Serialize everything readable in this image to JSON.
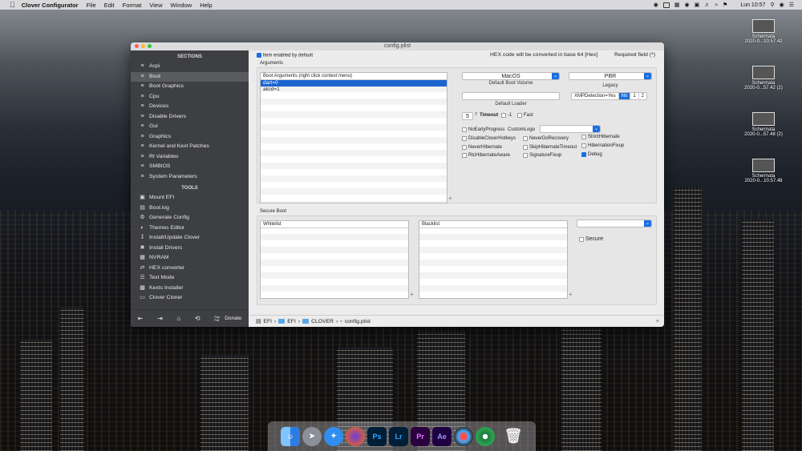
{
  "menubar": {
    "app": "Clover Configurator",
    "items": [
      "File",
      "Edit",
      "Format",
      "View",
      "Window",
      "Help"
    ],
    "clock": "Lun 10:57"
  },
  "desktop": [
    {
      "label": "Schermata",
      "sub": "2020-0...10.57.42"
    },
    {
      "label": "Schermata",
      "sub": "2020-0...57.42 (2)"
    },
    {
      "label": "Schermata",
      "sub": "2020-0...57.48 (2)"
    },
    {
      "label": "Schermata",
      "sub": "2020-0...10.57.48"
    }
  ],
  "window": {
    "title": "config.plist"
  },
  "sidebar": {
    "sections_header": "SECTIONS",
    "sections": [
      "Acpi",
      "Boot",
      "Boot Graphics",
      "Cpu",
      "Devices",
      "Disable Drivers",
      "Gui",
      "Graphics",
      "Kernel and Kext Patches",
      "Rt Variables",
      "SMBIOS",
      "System Parameters"
    ],
    "tools_header": "TOOLS",
    "tools": [
      "Mount EFI",
      "Boot.log",
      "Generate Config",
      "Themes Editor",
      "Install/Update Clover",
      "Install Drivers",
      "NVRAM",
      "HEX converter",
      "Text Mode",
      "Kexts Installer",
      "Clover Cloner"
    ],
    "donate": "Donate",
    "paypal": "Pay Pal"
  },
  "boot": {
    "enabled_label": "Item enabled by default",
    "hex_note": "HEX code will be converted in base 64 [Hex]",
    "required_note": "Required field (*)",
    "arguments_label": "Arguments",
    "args_header": "Boot Arguments (right click context menu)",
    "args": [
      "dart=0",
      "alcid=1"
    ],
    "default_volume_value": "MacOS",
    "default_volume_label": "Default Boot Volume",
    "legacy_value": "PBR",
    "legacy_label": "Legacy",
    "default_loader_label": "Default Loader",
    "xmp_label": "XMPDetection=Yes",
    "xmp_options": [
      "No",
      "1",
      "2"
    ],
    "timeout_value": "5",
    "timeout_label": "Timeout",
    "minus_one_label": "-1",
    "fast_label": "Fast",
    "customlogo_label": "CustomLogo",
    "flags": [
      [
        "NoEarlyProgress"
      ],
      [
        "DisableCloverHotkeys",
        "NeverDoRecovery",
        "StrictHibernate"
      ],
      [
        "NeverHibernate",
        "SkipHibernateTimeout",
        "HibernationFixup"
      ],
      [
        "RtcHibernateAware",
        "SignatureFixup",
        "Debug"
      ]
    ],
    "secure_boot_label": "Secure Boot",
    "whitelist_label": "Whitelist",
    "blacklist_label": "Blacklist",
    "secure_label": "Secure"
  },
  "pathbar": [
    "EFI",
    "EFI",
    "CLOVER",
    "config.plist"
  ],
  "dock": [
    "Finder",
    "Launchpad",
    "Safari",
    "Firefox",
    "Ps",
    "Lr",
    "Pr",
    "Ae",
    "DaVinci",
    "Chrome",
    "Trash"
  ]
}
